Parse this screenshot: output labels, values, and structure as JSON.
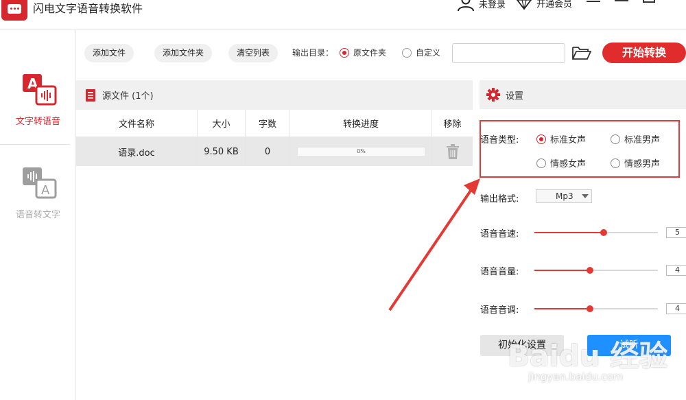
{
  "app": {
    "title": "闪电文字语音转换软件",
    "user_label": "未登录",
    "vip_label": "开通会员"
  },
  "sidebar": {
    "items": [
      {
        "label": "文字转语音",
        "active": true
      },
      {
        "label": "语音转文字",
        "active": false
      }
    ]
  },
  "toolbar": {
    "add_file": "添加文件",
    "add_folder": "添加文件夹",
    "clear_list": "清空列表",
    "output_dir_label": "输出目录：",
    "radio_source": "原文件夹",
    "radio_custom": "自定义",
    "path_value": "",
    "start_label": "开始转换"
  },
  "files": {
    "header": "源文件 (1个)",
    "columns": [
      "文件名称",
      "大小",
      "字数",
      "转换进度",
      "移除"
    ],
    "rows": [
      {
        "name": "语录.doc",
        "size": "9.50 KB",
        "chars": "0",
        "progress": "0%"
      }
    ]
  },
  "settings": {
    "title": "设置",
    "voice_type_label": "语音类型:",
    "voices": [
      "标准女声",
      "标准男声",
      "情感女声",
      "情感男声"
    ],
    "selected_voice": "标准女声",
    "format_label": "输出格式:",
    "format_value": "Mp3",
    "speed_label": "语音音速:",
    "speed_value": "5",
    "speed_level": 0.56,
    "volume_label": "语音音量:",
    "volume_value": "4",
    "volume_level": 0.45,
    "pitch_label": "语音音调:",
    "pitch_value": "4",
    "pitch_level": 0.45,
    "reset_label": "初始化设置",
    "listen_label": "试听"
  },
  "watermark": {
    "brand": "Baidu 经验",
    "url": "jingyan.baidu.com"
  },
  "colors": {
    "accent": "#d6262e",
    "start_button": "#e02c2c",
    "listen_button": "#1e90ff",
    "highlight_box": "#e53935"
  }
}
